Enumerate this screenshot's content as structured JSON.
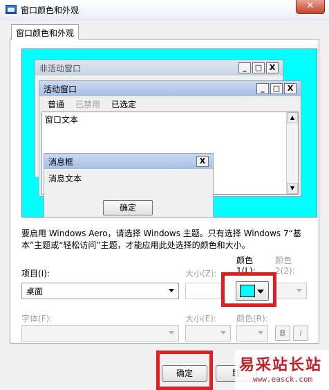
{
  "window": {
    "title": "窗口颜色和外观",
    "close_glyph": "✕"
  },
  "tab": {
    "label": "窗口颜色和外观"
  },
  "preview": {
    "inactive_title": "非活动窗口",
    "active_title": "活动窗口",
    "menu": {
      "normal": "普通",
      "disabled": "已禁用",
      "selected": "已选定"
    },
    "window_text": "窗口文本",
    "msgbox_title": "消息框",
    "msgbox_text": "消息文本",
    "msgbox_ok": "确定",
    "btn_min": "_",
    "btn_max": "□",
    "btn_close": "X",
    "preview_color": "#00ffff"
  },
  "info_text": "要启用 Windows Aero，请选择 Windows 主题。只有选择 Windows 7“基本”主题或“轻松访问”主题，才能应用此处选择的颜色和大小。",
  "fields": {
    "item_label": "项目(I):",
    "item_value": "桌面",
    "size_label": "大小(Z):",
    "color1_label": "颜色 1(L):",
    "color2_label": "颜色 2(2):",
    "font_label": "字体(F):",
    "size2_label": "大小(E):",
    "color_label": "颜色(R):",
    "bold": "B",
    "italic": "I"
  },
  "buttons": {
    "ok": "确定",
    "cancel": "取"
  },
  "watermark": {
    "main": "易采站长站",
    "sub": "www.easck.com"
  },
  "colors": {
    "highlight": "#e02020",
    "color1": "#00ffff"
  }
}
